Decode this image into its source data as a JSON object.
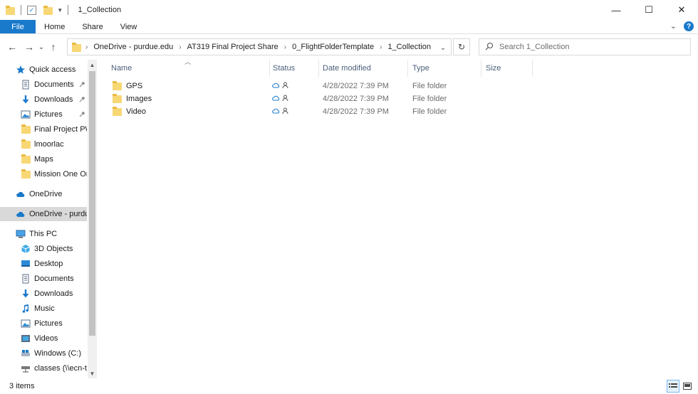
{
  "window": {
    "title": "1_Collection",
    "controls": {
      "minimize": "—",
      "maximize": "☐",
      "close": "✕"
    }
  },
  "ribbon": {
    "tabs": [
      "File",
      "Home",
      "Share",
      "View"
    ],
    "expand_glyph": "⌄",
    "help_glyph": "?"
  },
  "nav": {
    "back": "←",
    "forward": "→",
    "recent": "⌄",
    "up": "↑",
    "refresh": "↻",
    "dropdown": "⌄"
  },
  "address": {
    "crumbs": [
      "OneDrive - purdue.edu",
      "AT319 Final Project Share",
      "0_FlightFolderTemplate",
      "1_Collection"
    ],
    "sep": "›"
  },
  "search": {
    "placeholder": "Search 1_Collection"
  },
  "sidebar": {
    "items": [
      {
        "label": "Quick access",
        "icon": "star-icon"
      },
      {
        "label": "Documents",
        "icon": "documents-icon",
        "pinned": true
      },
      {
        "label": "Downloads",
        "icon": "download-icon",
        "pinned": true
      },
      {
        "label": "Pictures",
        "icon": "pictures-icon",
        "pinned": true
      },
      {
        "label": "Final Project PW",
        "icon": "folder-icon"
      },
      {
        "label": "lmoorlac",
        "icon": "folder-icon"
      },
      {
        "label": "Maps",
        "icon": "folder-icon"
      },
      {
        "label": "Mission One Ort",
        "icon": "folder-icon"
      },
      {
        "label": "OneDrive",
        "icon": "cloud-icon"
      },
      {
        "label": "OneDrive - purdue",
        "icon": "cloud-icon",
        "selected": true
      },
      {
        "label": "This PC",
        "icon": "computer-icon"
      },
      {
        "label": "3D Objects",
        "icon": "cube-icon"
      },
      {
        "label": "Desktop",
        "icon": "desktop-icon"
      },
      {
        "label": "Documents",
        "icon": "documents-icon"
      },
      {
        "label": "Downloads",
        "icon": "download-icon"
      },
      {
        "label": "Music",
        "icon": "music-icon"
      },
      {
        "label": "Pictures",
        "icon": "pictures-icon"
      },
      {
        "label": "Videos",
        "icon": "video-icon"
      },
      {
        "label": "Windows (C:)",
        "icon": "drive-icon"
      },
      {
        "label": "classes (\\\\ecn-te",
        "icon": "network-drive-icon"
      }
    ],
    "pin_glyph": "📌"
  },
  "columns": [
    "Name",
    "Status",
    "Date modified",
    "Type",
    "Size"
  ],
  "files": [
    {
      "name": "GPS",
      "date": "4/28/2022 7:39 PM",
      "type": "File folder"
    },
    {
      "name": "Images",
      "date": "4/28/2022 7:39 PM",
      "type": "File folder"
    },
    {
      "name": "Video",
      "date": "4/28/2022 7:39 PM",
      "type": "File folder"
    }
  ],
  "statusbar": {
    "count": "3 items"
  },
  "colors": {
    "accent": "#1979ca",
    "selection": "#d9d9d9",
    "folder": "#f8d775"
  }
}
